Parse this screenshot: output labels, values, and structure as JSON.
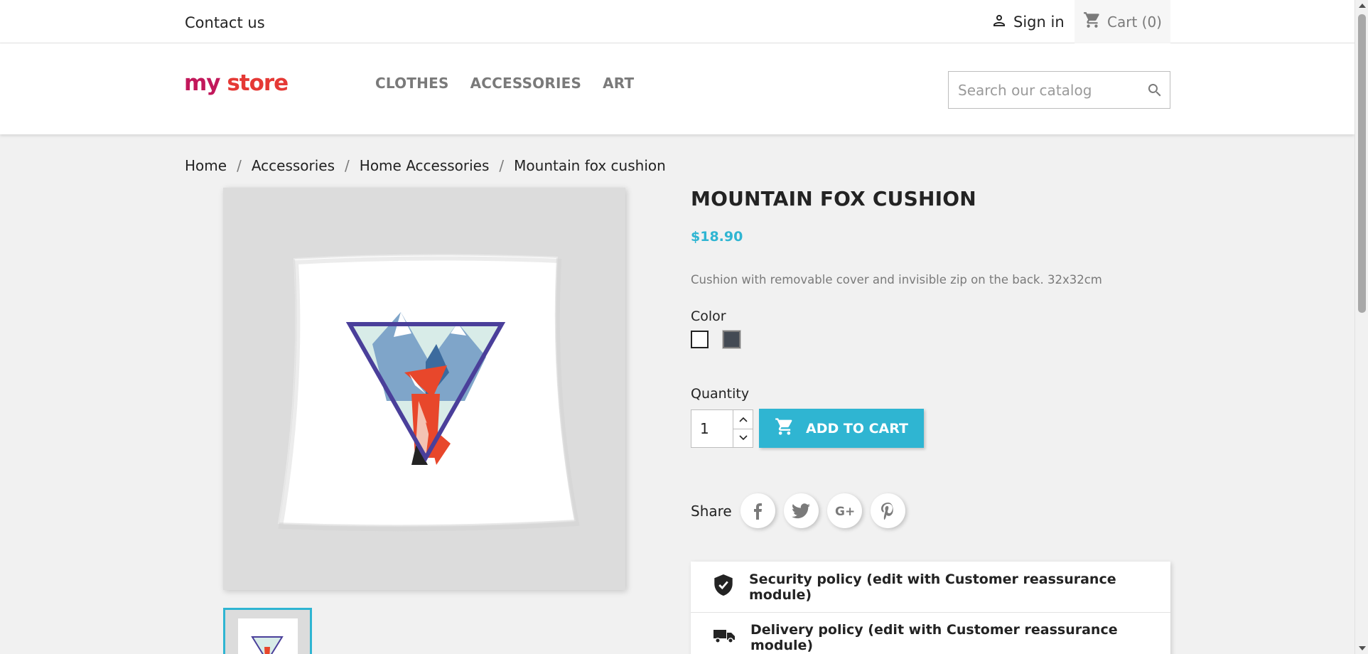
{
  "top_nav": {
    "contact": "Contact us",
    "signin": "Sign in",
    "cart": "Cart (0)"
  },
  "header": {
    "logo_parts": [
      "my",
      "store"
    ],
    "menu": [
      "CLOTHES",
      "ACCESSORIES",
      "ART"
    ],
    "search_placeholder": "Search our catalog"
  },
  "breadcrumb": [
    "Home",
    "Accessories",
    "Home Accessories",
    "Mountain fox cushion"
  ],
  "product": {
    "title": "MOUNTAIN FOX CUSHION",
    "price": "$18.90",
    "description": "Cushion with removable cover and invisible zip on the back. 32x32cm",
    "color_label": "Color",
    "colors": [
      {
        "name": "White",
        "hex": "#ffffff",
        "selected": true
      },
      {
        "name": "Grey",
        "hex": "#434a54",
        "selected": false
      }
    ],
    "quantity_label": "Quantity",
    "quantity": "1",
    "add_to_cart": "ADD TO CART",
    "share_label": "Share",
    "social": [
      "facebook-icon",
      "twitter-icon",
      "google-plus-icon",
      "pinterest-icon"
    ]
  },
  "reassurance": [
    "Security policy (edit with Customer reassurance module)",
    "Delivery policy (edit with Customer reassurance module)"
  ],
  "colors": {
    "accent": "#2fb5d2",
    "text": "#232323",
    "muted": "#7a7a7a",
    "background": "#f1f1f1"
  }
}
